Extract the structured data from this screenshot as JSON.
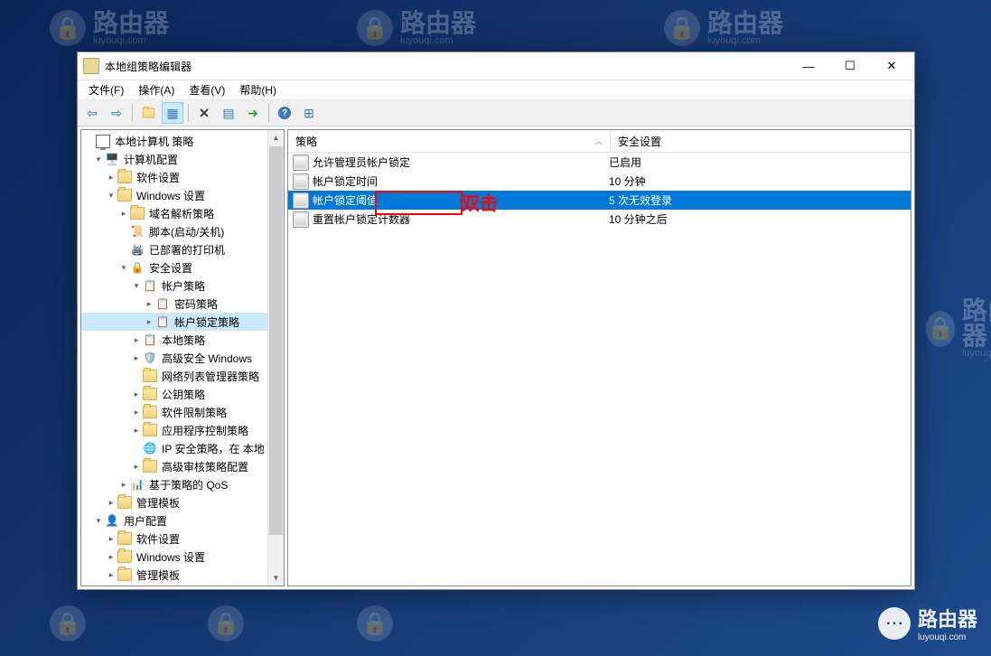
{
  "watermark": {
    "text": "路由器",
    "sub": "luyouqi.com"
  },
  "window": {
    "title": "本地组策略编辑器",
    "menu": {
      "file": "文件(F)",
      "action": "操作(A)",
      "view": "查看(V)",
      "help": "帮助(H)"
    },
    "win_controls": {
      "min": "—",
      "max": "☐",
      "close": "✕"
    }
  },
  "toolbar": {
    "back": "⬅",
    "forward": "➡",
    "up": "📂",
    "props": "☰",
    "delete": "✖",
    "refresh": "⟳",
    "export": "➜",
    "help": "?",
    "showhide": "⊞"
  },
  "tree": {
    "root": "本地计算机 策略",
    "computer_config": "计算机配置",
    "software_settings": "软件设置",
    "windows_settings": "Windows 设置",
    "name_resolution": "域名解析策略",
    "scripts": "脚本(启动/关机)",
    "deployed_printers": "已部署的打印机",
    "security_settings": "安全设置",
    "account_policies": "帐户策略",
    "password_policy": "密码策略",
    "account_lockout_policy": "帐户锁定策略",
    "local_policies": "本地策略",
    "adv_security_windows": "高级安全 Windows",
    "network_list_mgr": "网络列表管理器策略",
    "public_key_policies": "公钥策略",
    "software_restriction": "软件限制策略",
    "app_control_policies": "应用程序控制策略",
    "ip_security": "IP 安全策略，在 本地",
    "adv_audit_config": "高级审核策略配置",
    "policy_based_qos": "基于策略的 QoS",
    "admin_templates_1": "管理模板",
    "user_config": "用户配置",
    "software_settings_2": "软件设置",
    "windows_settings_2": "Windows 设置",
    "admin_templates_2": "管理模板"
  },
  "list": {
    "col_policy": "策略",
    "col_security": "安全设置",
    "rows": [
      {
        "name": "允许管理员帐户锁定",
        "value": "已启用"
      },
      {
        "name": "帐户锁定时间",
        "value": "10 分钟"
      },
      {
        "name": "帐户锁定阈值",
        "value": "5 次无效登录"
      },
      {
        "name": "重置帐户锁定计数器",
        "value": "10 分钟之后"
      }
    ]
  },
  "annotation": {
    "text": "双击"
  }
}
